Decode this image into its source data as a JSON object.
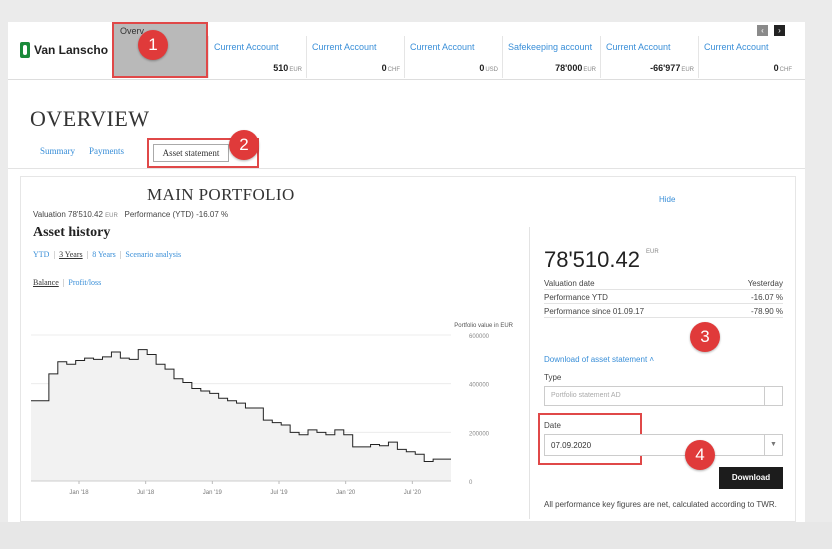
{
  "header": {
    "logo_text": "Van Lanscho",
    "overview_tab": "Overv",
    "accounts": [
      {
        "name": "Current Account",
        "value": "510",
        "currency": "EUR"
      },
      {
        "name": "Current Account",
        "value": "0",
        "currency": "CHF"
      },
      {
        "name": "Current Account",
        "value": "0",
        "currency": "USD"
      },
      {
        "name": "Safekeeping account",
        "value": "78'000",
        "currency": "EUR"
      },
      {
        "name": "Current Account",
        "value": "-66'977",
        "currency": "EUR"
      },
      {
        "name": "Current Account",
        "value": "0",
        "currency": "CHF"
      }
    ],
    "prev_label": "‹",
    "next_label": "›"
  },
  "overview": {
    "title": "OVERVIEW",
    "tabs": [
      "Summary",
      "Payments",
      "Asset statement"
    ]
  },
  "portfolio": {
    "title": "MAIN PORTFOLIO",
    "hide": "Hide",
    "valuation_label": "Valuation",
    "valuation_value": "78'510.42",
    "valuation_currency": "EUR",
    "performance_label": "Performance (YTD)",
    "performance_value": "-16.07 %",
    "asset_history": "Asset history",
    "range_tabs": [
      "YTD",
      "3 Years",
      "8 Years",
      "Scenario analysis"
    ],
    "balance_tabs": [
      "Balance",
      "Profit/loss"
    ]
  },
  "summary_panel": {
    "big_value": "78'510.42",
    "big_currency": "EUR",
    "rows": [
      {
        "label": "Valuation date",
        "value": "Yesterday"
      },
      {
        "label": "Performance YTD",
        "value": "-16.07 %"
      },
      {
        "label": "Performance since 01.09.17",
        "value": "-78.90 %"
      }
    ],
    "download_link": "Download of asset statement",
    "type_label": "Type",
    "type_placeholder": "Portfolio statement AD",
    "date_label": "Date",
    "date_value": "07.09.2020",
    "download_button": "Download",
    "note": "All performance key figures are net, calculated according to TWR."
  },
  "steps": [
    "1",
    "2",
    "3",
    "4"
  ],
  "colors": {
    "accent": "#3a8fd8",
    "highlight": "#e04848",
    "logo": "#1a8a3a"
  },
  "chart_data": {
    "type": "area",
    "title": "",
    "ylabel": "Portfolio value in EUR",
    "x": [
      "Jan '18",
      "Jul '18",
      "Jan '19",
      "Jul '19",
      "Jan '20",
      "Jul '20"
    ],
    "ylim": [
      0,
      600000
    ],
    "yticks": [
      "600000",
      "400000",
      "200000",
      "0"
    ],
    "series": [
      {
        "values": [
          330000,
          330000,
          440000,
          490000,
          480000,
          495000,
          505000,
          500000,
          510000,
          530000,
          505000,
          500000,
          540000,
          520000,
          480000,
          460000,
          420000,
          405000,
          380000,
          370000,
          360000,
          340000,
          330000,
          320000,
          300000,
          300000,
          250000,
          240000,
          230000,
          200000,
          190000,
          210000,
          200000,
          190000,
          210000,
          190000,
          140000,
          140000,
          150000,
          145000,
          160000,
          130000,
          120000,
          110000,
          80000,
          90000,
          90000
        ]
      }
    ]
  }
}
